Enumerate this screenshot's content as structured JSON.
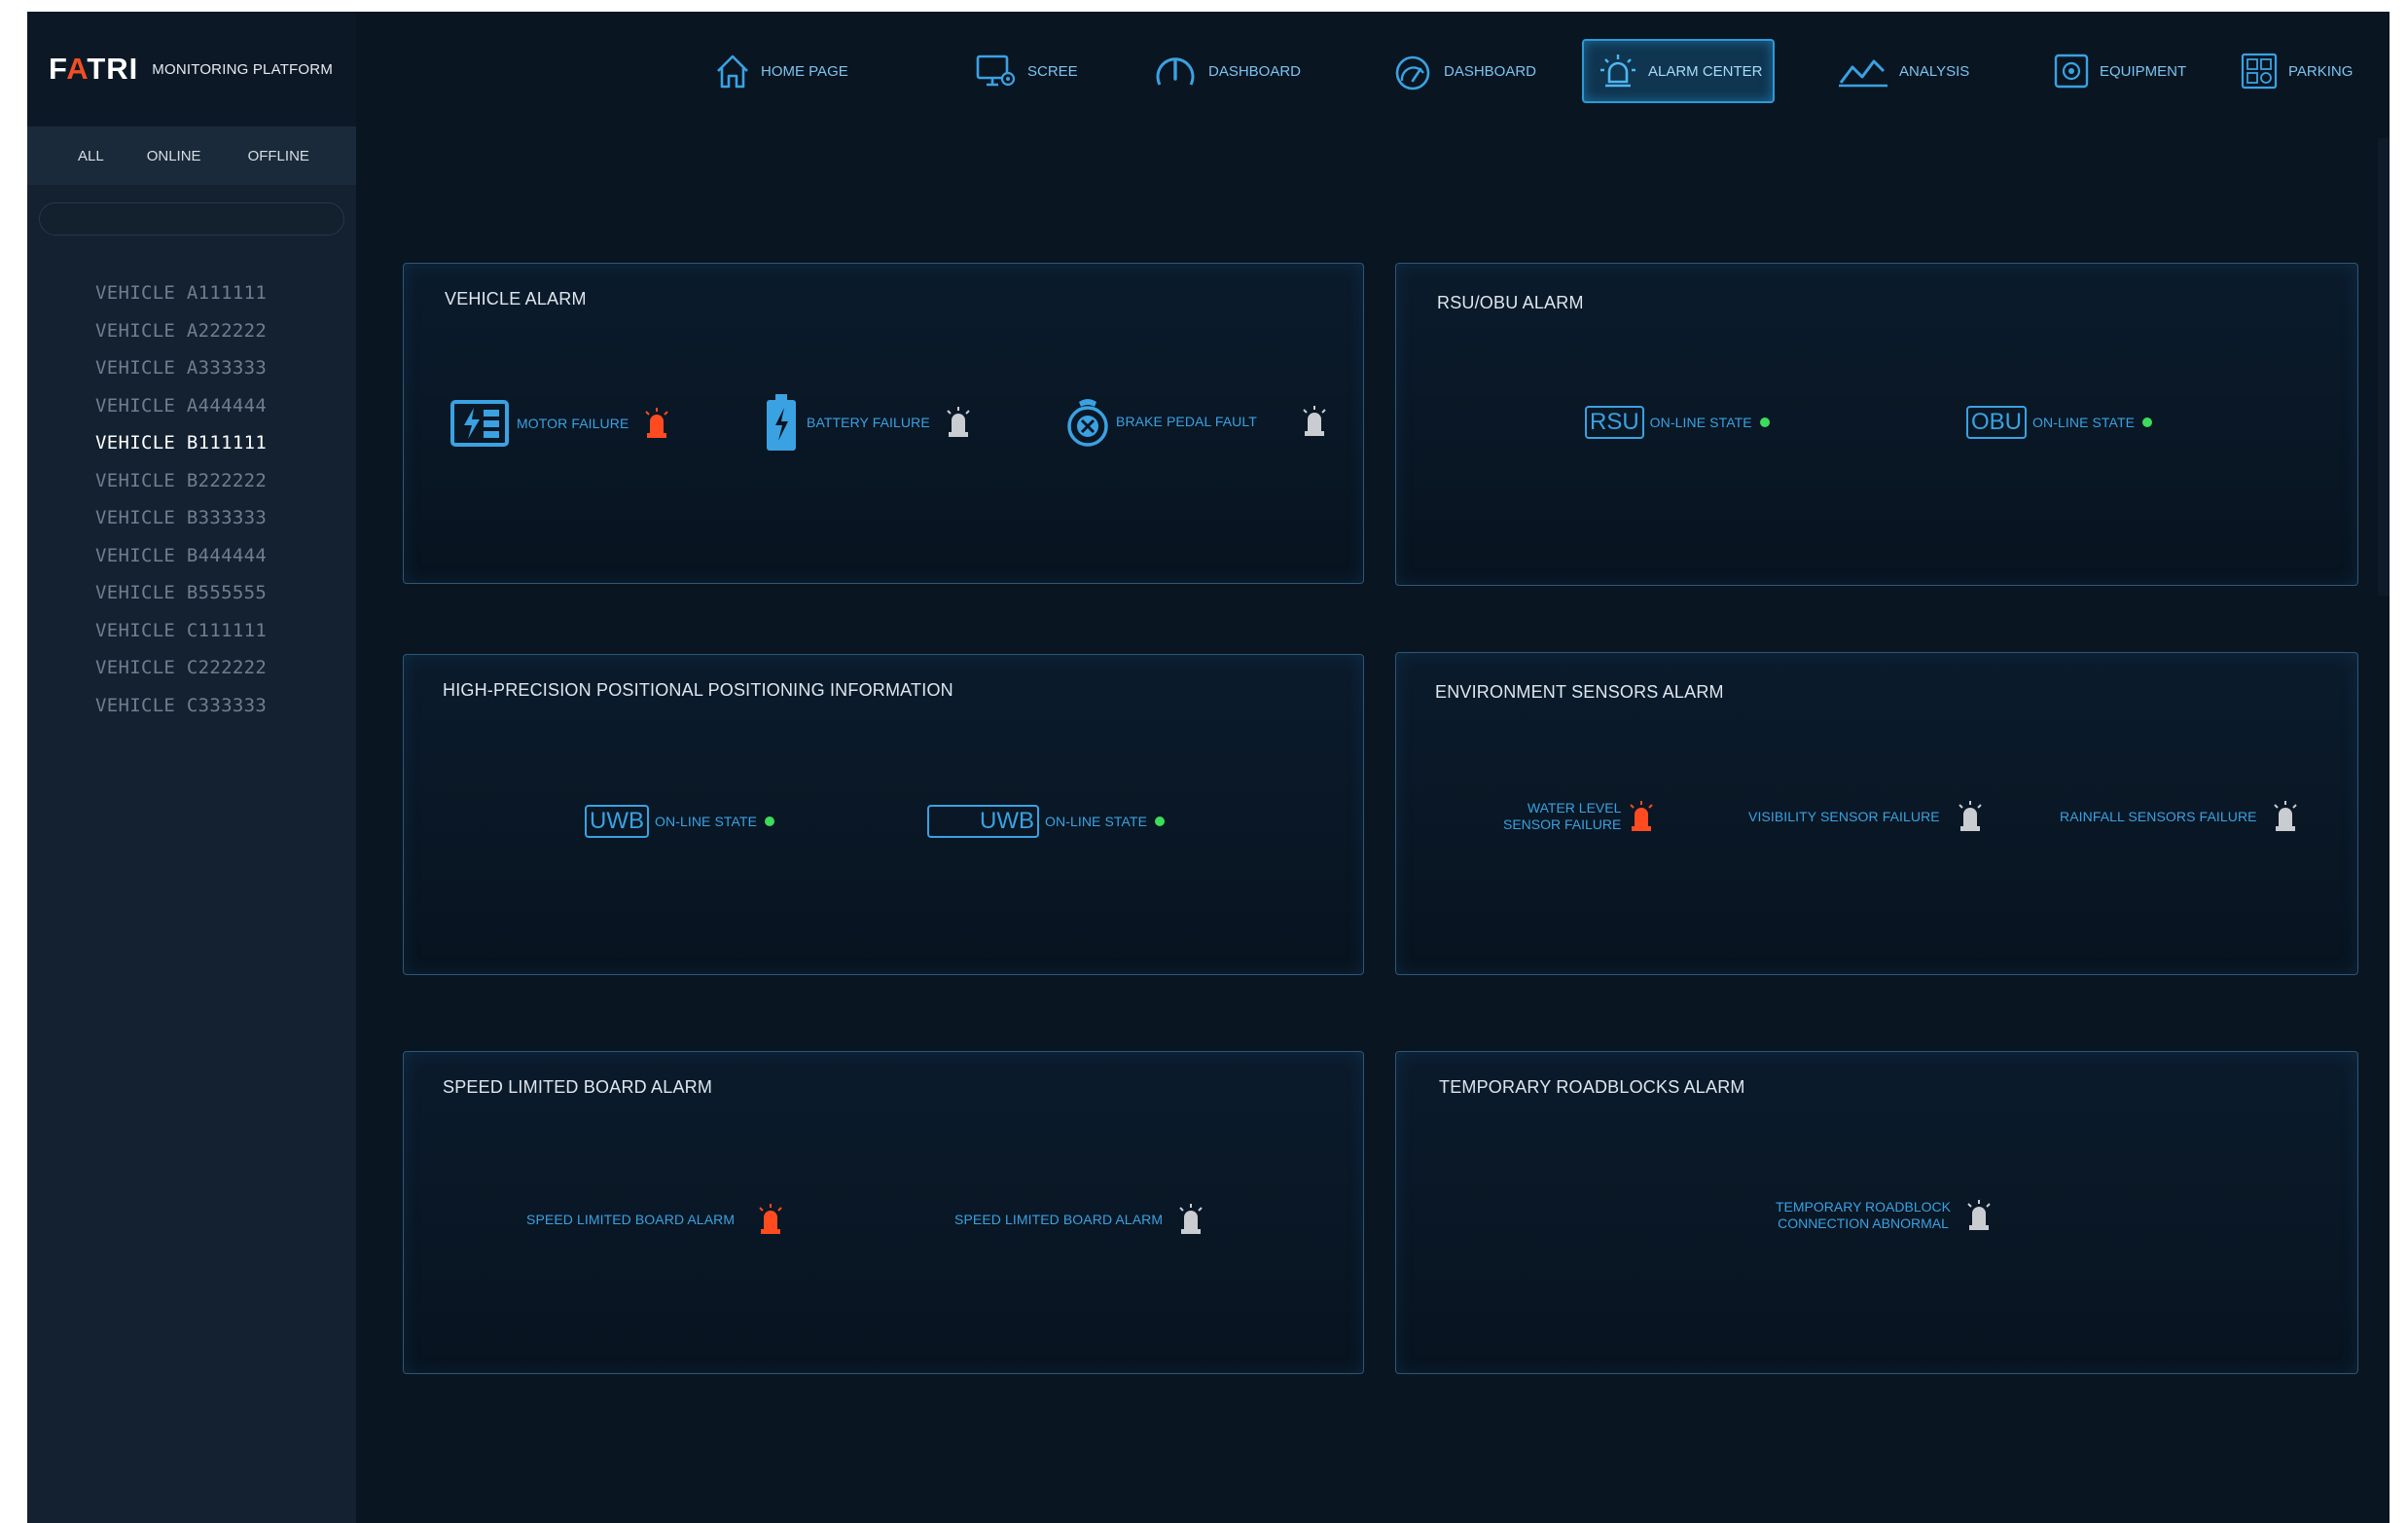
{
  "brand": {
    "logo_left": "F",
    "logo_accent": "A",
    "logo_right": "TRI",
    "platform": "MONITORING PLATFORM"
  },
  "filters": {
    "all": "ALL",
    "online": "ONLINE",
    "offline": "OFFLINE"
  },
  "search": {
    "placeholder": "",
    "value": ""
  },
  "vehicles": [
    "VEHICLE A111111",
    "VEHICLE A222222",
    "VEHICLE A333333",
    "VEHICLE A444444",
    "VEHICLE B111111",
    "VEHICLE B222222",
    "VEHICLE B333333",
    "VEHICLE B444444",
    "VEHICLE B555555",
    "VEHICLE C111111",
    "VEHICLE C222222",
    "VEHICLE C333333"
  ],
  "selected_vehicle": "VEHICLE B111111",
  "nav": {
    "home": "HOME PAGE",
    "scree": "SCREE",
    "dashboard1": "DASHBOARD",
    "dashboard2": "DASHBOARD",
    "alarm_center": "ALARM CENTER",
    "analysis": "ANALYSIS",
    "equipment": "EQUIPMENT",
    "parking": "PARKING",
    "active": "ALARM CENTER"
  },
  "colors": {
    "alarm_active": "#ff4b1f",
    "alarm_idle": "#c9cdd2",
    "online": "#3ddc5a",
    "accent": "#3aa2e2",
    "background": "#0a1522"
  },
  "panels": {
    "vehicle_alarm": {
      "title": "VEHICLE ALARM",
      "items": [
        {
          "label": "MOTOR FAILURE",
          "icon": "motor-icon",
          "alarm": "active"
        },
        {
          "label": "BATTERY FAILURE",
          "icon": "battery-icon",
          "alarm": "idle"
        },
        {
          "label": "BRAKE PEDAL FAULT",
          "icon": "brake-icon",
          "alarm": "idle"
        }
      ]
    },
    "rsu_obu": {
      "title": "RSU/OBU ALARM",
      "items": [
        {
          "badge": "RSU",
          "label": "ON-LINE STATE",
          "status": "online"
        },
        {
          "badge": "OBU",
          "label": "ON-LINE STATE",
          "status": "online"
        }
      ]
    },
    "positioning": {
      "title": "HIGH-PRECISION POSITIONAL POSITIONING INFORMATION",
      "items": [
        {
          "badge": "UWB",
          "label": "ON-LINE STATE",
          "status": "online"
        },
        {
          "badge": "UWB",
          "label": "ON-LINE STATE",
          "status": "online"
        }
      ]
    },
    "environment": {
      "title": "ENVIRONMENT SENSORS ALARM",
      "items": [
        {
          "label_line1": "WATER LEVEL",
          "label_line2": "SENSOR FAILURE",
          "alarm": "active"
        },
        {
          "label": "VISIBILITY SENSOR FAILURE",
          "alarm": "idle"
        },
        {
          "label": "RAINFALL SENSORS FAILURE",
          "alarm": "idle"
        }
      ]
    },
    "speed_board": {
      "title": "SPEED LIMITED BOARD ALARM",
      "items": [
        {
          "label": "SPEED LIMITED BOARD ALARM",
          "alarm": "active"
        },
        {
          "label": "SPEED LIMITED BOARD ALARM",
          "alarm": "idle"
        }
      ]
    },
    "roadblocks": {
      "title": "TEMPORARY ROADBLOCKS ALARM",
      "items": [
        {
          "label_line1": "TEMPORARY ROADBLOCK",
          "label_line2": "CONNECTION ABNORMAL",
          "alarm": "idle"
        }
      ]
    }
  }
}
